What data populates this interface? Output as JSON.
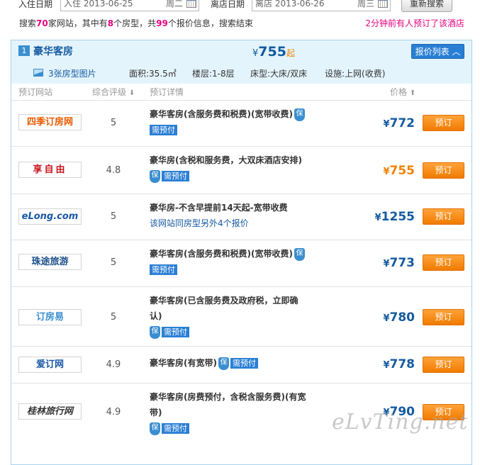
{
  "search": {
    "checkin_label": "入住日期",
    "checkin_value": "入住 2013-06-25",
    "checkin_dow": "周二",
    "checkout_label": "离店日期",
    "checkout_value": "离店 2013-06-26",
    "checkout_dow": "周三",
    "research_button": "重新搜索"
  },
  "summary": {
    "p1": "搜索",
    "sites": "70",
    "p2": "家网站，其中有",
    "room_types": "8",
    "p3": "个房型，共",
    "offers": "99",
    "p4": "个报价信息，搜索结束",
    "recent_booking": "2分钟前有人预订了该酒店"
  },
  "room": {
    "index": "1",
    "name": "豪华客房",
    "price_currency": "¥",
    "price_value": "755",
    "price_suffix": "起",
    "list_button": "报价列表 ︿",
    "photos": "3张房型图片",
    "area": "面积:35.5㎡",
    "floor": "楼层:1-8层",
    "bed": "床型:大床/双床",
    "facility": "设施:上网(收费)"
  },
  "columns": {
    "site": "预订网站",
    "rating": "综合评级",
    "rating_sort": "⬇",
    "detail": "预订详情",
    "price": "价格",
    "price_sort": "⬆"
  },
  "offers": [
    {
      "site": "四季订房网",
      "rating": "5",
      "title": "豪华客房(含服务费和税费)(宽带收费)",
      "guarantee": "保",
      "prepay": "需预付",
      "price": "772",
      "book": "预订",
      "logo_color": "#e85a00"
    },
    {
      "site": "享自由",
      "rating": "4.8",
      "title": "豪华房(含税和服务费，大双床酒店安排)",
      "guarantee": "保",
      "prepay": "需预付",
      "price": "755",
      "book": "预订",
      "logo_color": "#c8161d"
    },
    {
      "site": "eLong.com",
      "rating": "5",
      "title": "豪华房-不含早提前14天起-宽带收费",
      "extra": "该网站同房型另外4个报价",
      "price": "1255",
      "book": "预订",
      "logo_color": "#1a57a6"
    },
    {
      "site": "珠途旅游",
      "rating": "5",
      "title": "豪华客房(含服务费和税费)(宽带收费)",
      "guarantee": "保",
      "prepay": "需预付",
      "price": "773",
      "book": "预订",
      "logo_color": "#1a4f8a"
    },
    {
      "site": "订房易",
      "rating": "5",
      "title_l1": "豪华客房(已含服务费及政府税，立即确",
      "title_l2": "认)",
      "guarantee": "保",
      "prepay": "需预付",
      "price": "780",
      "book": "预订",
      "logo_color": "#3a8ecf"
    },
    {
      "site": "爱订网",
      "rating": "4.9",
      "title": "豪华客房(有宽带)",
      "guarantee": "保",
      "prepay": "需预付",
      "price": "778",
      "book": "预订",
      "logo_color": "#1a57a6"
    },
    {
      "site": "桂林旅行网",
      "rating": "4.9",
      "title_l1": "豪华客房(房费预付，含税含服务费)(有宽",
      "title_l2": "带)",
      "guarantee": "保",
      "prepay": "需预付",
      "price": "790",
      "book": "预订",
      "logo_color": "#333333"
    }
  ],
  "currency": "¥",
  "watermark": "eLvTing.net",
  "colors": {
    "accent_blue": "#145aa0",
    "highlight": "#e4007f",
    "book_orange": "#f08200",
    "header_bg": "#e4f4fc"
  }
}
